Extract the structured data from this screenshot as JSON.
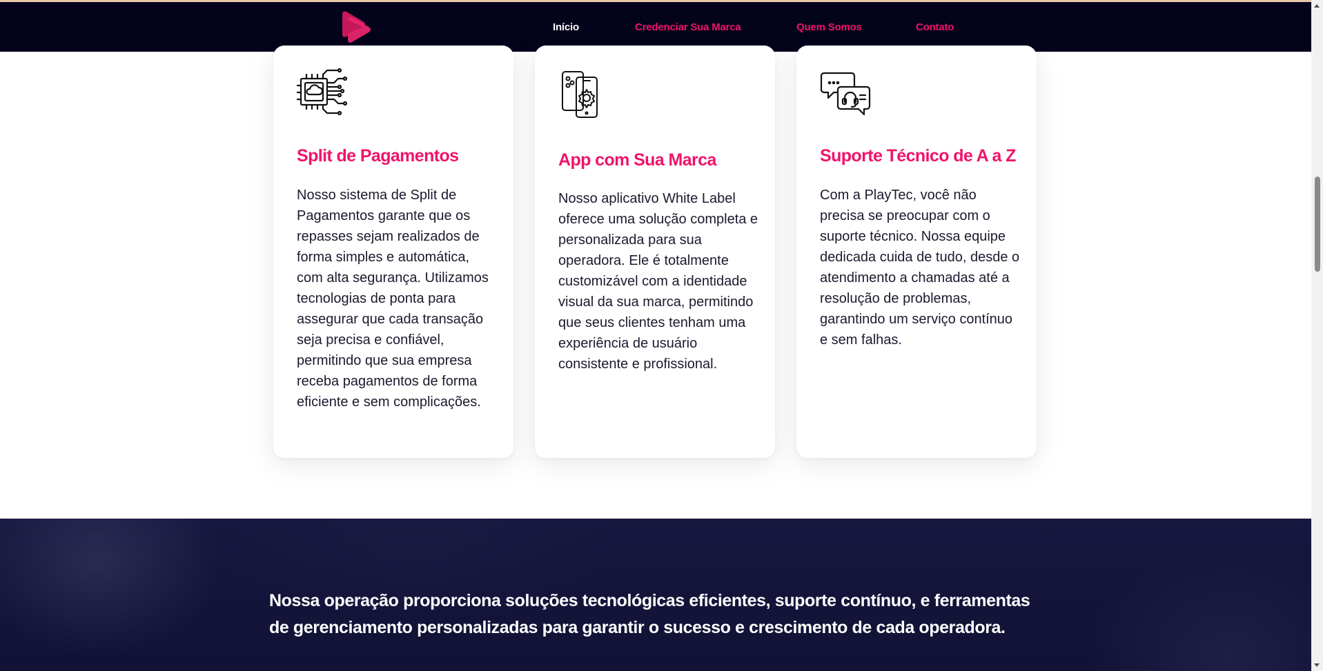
{
  "nav": {
    "items": [
      {
        "label": "Início",
        "active": true
      },
      {
        "label": "Credenciar Sua Marca",
        "active": false
      },
      {
        "label": "Quem Somos",
        "active": false
      },
      {
        "label": "Contato",
        "active": false
      }
    ]
  },
  "features": [
    {
      "icon": "cloud-chip-icon",
      "title": "Split de Pagamentos",
      "text": "Nosso sistema de Split de Pagamentos garante que os repasses sejam realizados de forma simples e automática, com alta segurança. Utilizamos tecnologias de ponta para assegurar que cada transação seja precisa e confiável, permitindo que sua empresa receba pagamentos de forma eficiente e sem complicações."
    },
    {
      "icon": "mobile-settings-icon",
      "title": "App com Sua Marca",
      "text": "Nosso aplicativo White Label oferece uma solução completa e personalizada para sua operadora. Ele é totalmente customizável com a identidade visual da sua marca, permitindo que seus clientes tenham uma experiência de usuário consistente e profissional."
    },
    {
      "icon": "support-chat-icon",
      "title": "Suporte Técnico de A a Z",
      "text": "Com a PlayTec, você não precisa se preocupar com o suporte técnico. Nossa equipe dedicada cuida de tudo, desde o atendimento a chamadas até a resolução de problemas, garantindo um serviço contínuo e sem falhas."
    }
  ],
  "banner": {
    "text": "Nossa operação proporciona soluções tecnológicas eficientes, suporte contínuo, e ferramentas de gerenciamento personalizadas para garantir o sucesso e crescimento de cada operadora."
  },
  "colors": {
    "accent": "#f0136a",
    "nav_background": "#04031c",
    "banner_background": "#14143a"
  }
}
